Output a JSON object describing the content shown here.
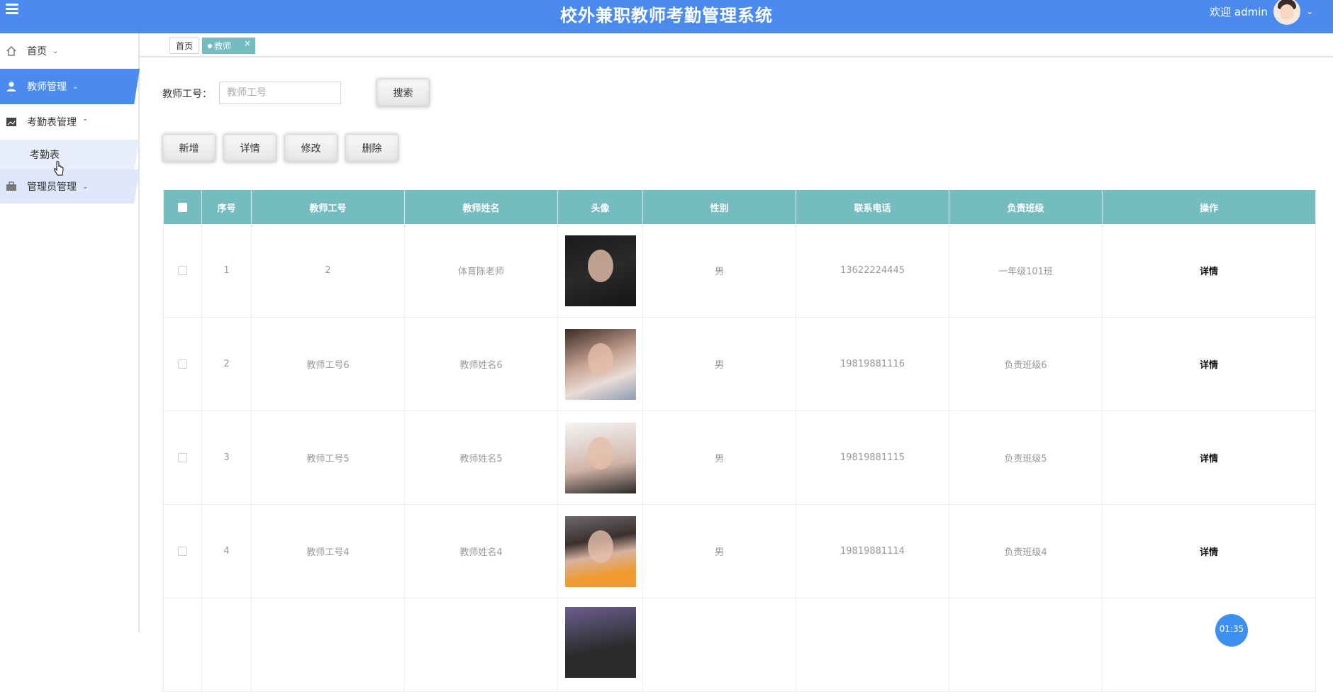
{
  "header": {
    "title": "校外兼职教师考勤管理系统",
    "welcome": "欢迎 admin",
    "accent_color": "#4b8bf0"
  },
  "sidebar": {
    "items": [
      {
        "label": "首页",
        "icon": "home-icon"
      },
      {
        "label": "教师管理",
        "icon": "user-icon"
      },
      {
        "label": "考勤表管理",
        "icon": "image-icon"
      },
      {
        "label": "考勤表",
        "icon": ""
      },
      {
        "label": "管理员管理",
        "icon": "briefcase-icon"
      }
    ]
  },
  "tabs": {
    "home": "首页",
    "active": "教师",
    "close": "×"
  },
  "search": {
    "label": "教师工号：",
    "placeholder": "教师工号",
    "button": "搜索"
  },
  "toolbar": {
    "add": "新增",
    "detail": "详情",
    "edit": "修改",
    "delete": "删除"
  },
  "table": {
    "header_color": "#74bcc0",
    "columns": [
      "序号",
      "教师工号",
      "教师姓名",
      "头像",
      "性别",
      "联系电话",
      "负责班级",
      "操作"
    ],
    "rows": [
      {
        "index": "1",
        "id": "2",
        "name": "体育陈老师",
        "gender": "男",
        "phone": "13622224445",
        "class": "一年级101班",
        "action": "详情"
      },
      {
        "index": "2",
        "id": "教师工号6",
        "name": "教师姓名6",
        "gender": "男",
        "phone": "19819881116",
        "class": "负责班级6",
        "action": "详情"
      },
      {
        "index": "3",
        "id": "教师工号5",
        "name": "教师姓名5",
        "gender": "男",
        "phone": "19819881115",
        "class": "负责班级5",
        "action": "详情"
      },
      {
        "index": "4",
        "id": "教师工号4",
        "name": "教师姓名4",
        "gender": "男",
        "phone": "19819881114",
        "class": "负责班级4",
        "action": "详情"
      }
    ]
  },
  "timer": "01:35"
}
